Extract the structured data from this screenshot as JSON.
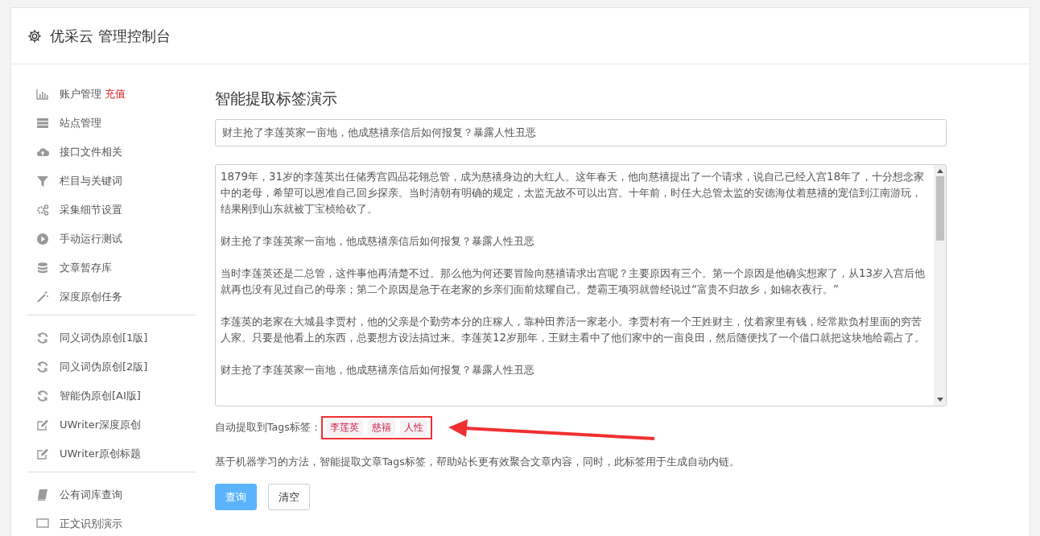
{
  "header": {
    "title": "优采云 管理控制台"
  },
  "sidebar": {
    "groups": [
      [
        {
          "label": "账户管理",
          "badge": "充值"
        },
        {
          "label": "站点管理"
        },
        {
          "label": "接口文件相关"
        },
        {
          "label": "栏目与关键词"
        },
        {
          "label": "采集细节设置"
        },
        {
          "label": "手动运行测试"
        },
        {
          "label": "文章暂存库"
        },
        {
          "label": "深度原创任务"
        }
      ],
      [
        {
          "label": "同义词伪原创[1版]"
        },
        {
          "label": "同义词伪原创[2版]"
        },
        {
          "label": "智能伪原创[AI版]"
        },
        {
          "label": "UWriter深度原创"
        },
        {
          "label": "UWriter原创标题"
        }
      ],
      [
        {
          "label": "公有词库查询"
        },
        {
          "label": "正文识别演示"
        }
      ]
    ]
  },
  "main": {
    "title": "智能提取标签演示",
    "title_field": {
      "value": "财主抢了李莲英家一亩地，他成慈禧亲信后如何报复？暴露人性丑恶"
    },
    "article_paragraphs": [
      "1879年，31岁的李莲英出任储秀宫四品花翎总管，成为慈禧身边的大红人。这年春天，他向慈禧提出了一个请求，说自己已经入宫18年了，十分想念家中的老母，希望可以恩准自己回乡探亲。当时清朝有明确的规定，太监无故不可以出宫。十年前，时任大总管太监的安德海仗着慈禧的宠信到江南游玩，结果刚到山东就被丁宝桢给砍了。",
      "财主抢了李莲英家一亩地，他成慈禧亲信后如何报复？暴露人性丑恶",
      "当时李莲英还是二总管，这件事他再清楚不过。那么他为何还要冒险向慈禧请求出宫呢？主要原因有三个。第一个原因是他确实想家了，从13岁入宫后他就再也没有见过自己的母亲；第二个原因是急于在老家的乡亲们面前炫耀自己。楚霸王项羽就曾经说过“富贵不归故乡，如锦衣夜行。”",
      "李莲英的老家在大城县李贾村，他的父亲是个勤劳本分的庄稼人，靠种田养活一家老小。李贾村有一个王姓财主，仗着家里有钱，经常欺负村里面的穷苦人家。只要是他看上的东西，总要想方设法搞过来。李莲英12岁那年，王财主看中了他们家中的一亩良田，然后随便找了一个借口就把这块地给霸占了。",
      "财主抢了李莲英家一亩地，他成慈禧亲信后如何报复？暴露人性丑恶"
    ],
    "tags_label": "自动提取到Tags标签：",
    "tags": [
      "李莲英",
      "慈禧",
      "人性"
    ],
    "description": "基于机器学习的方法，智能提取文章Tags标签，帮助站长更有效聚合文章内容，同时，此标签用于生成自动内链。",
    "buttons": [
      {
        "label": "查询",
        "kind": "primary"
      },
      {
        "label": "清空",
        "kind": "default"
      }
    ]
  }
}
